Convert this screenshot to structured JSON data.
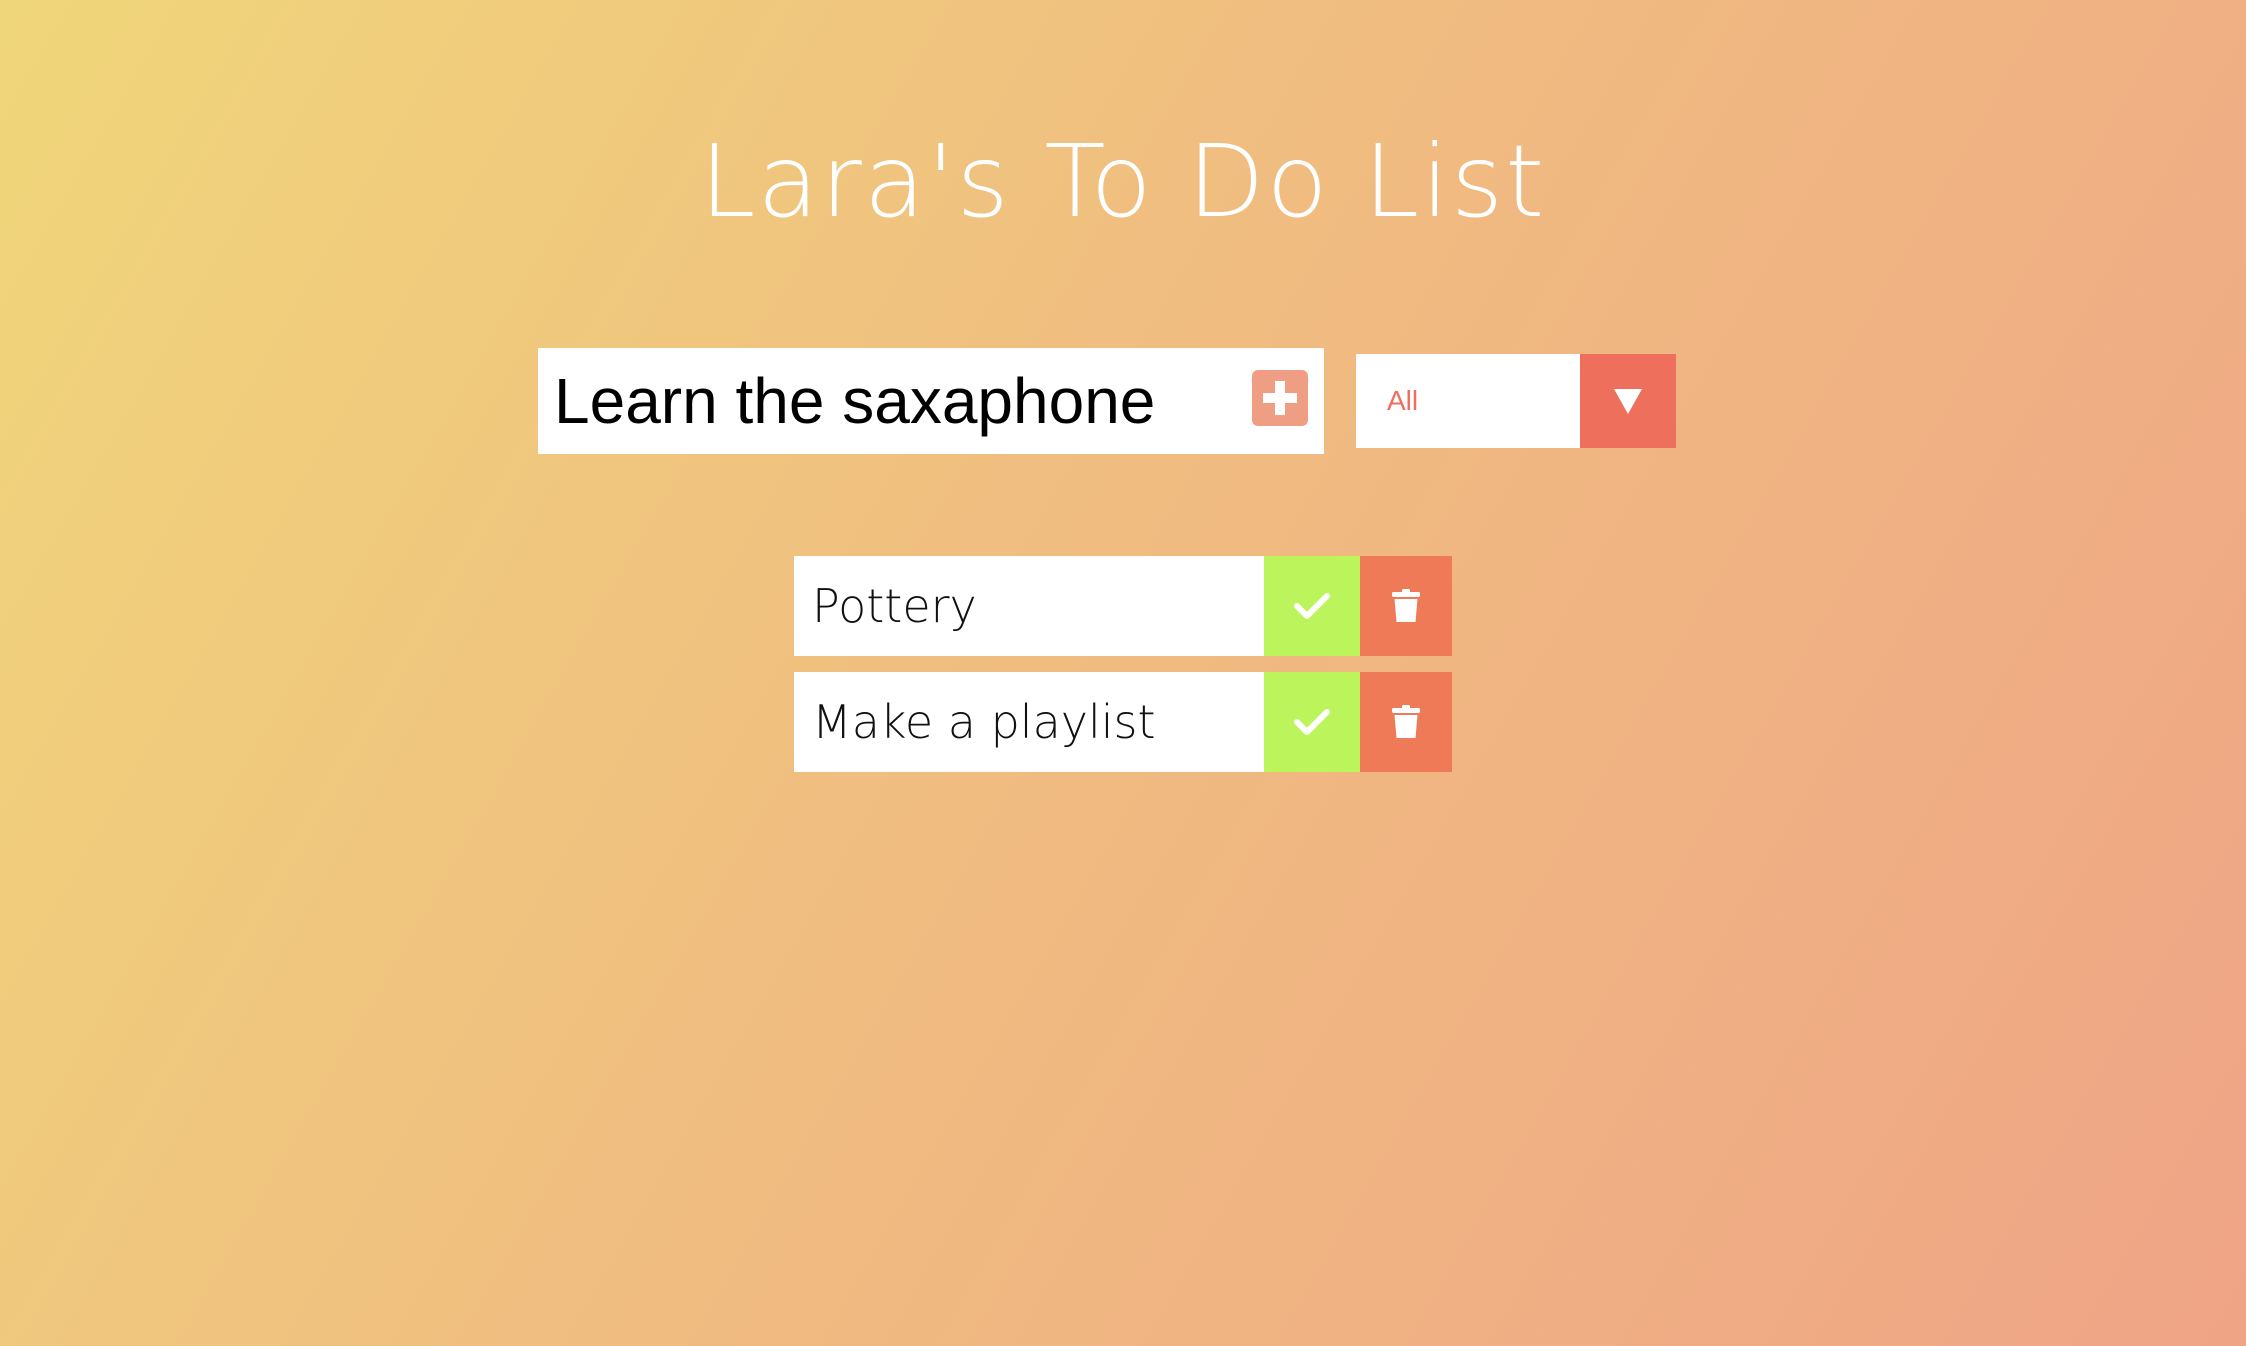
{
  "header": {
    "title": "Lara's To Do List"
  },
  "form": {
    "input_value": "Learn the saxaphone",
    "add_icon": "plus-square-icon",
    "filter": {
      "selected": "All",
      "arrow_icon": "triangle-down-icon"
    }
  },
  "todos": [
    {
      "text": "Pottery",
      "complete_icon": "check-icon",
      "delete_icon": "trash-icon"
    },
    {
      "text": "Make a playlist",
      "complete_icon": "check-icon",
      "delete_icon": "trash-icon"
    }
  ],
  "colors": {
    "background_start": "#f0d67a",
    "background_end": "#efa486",
    "add_button": "#ef9e84",
    "filter_accent": "#ee6f5c",
    "complete_button": "#bbf55b",
    "trash_button": "#ee7a57"
  }
}
